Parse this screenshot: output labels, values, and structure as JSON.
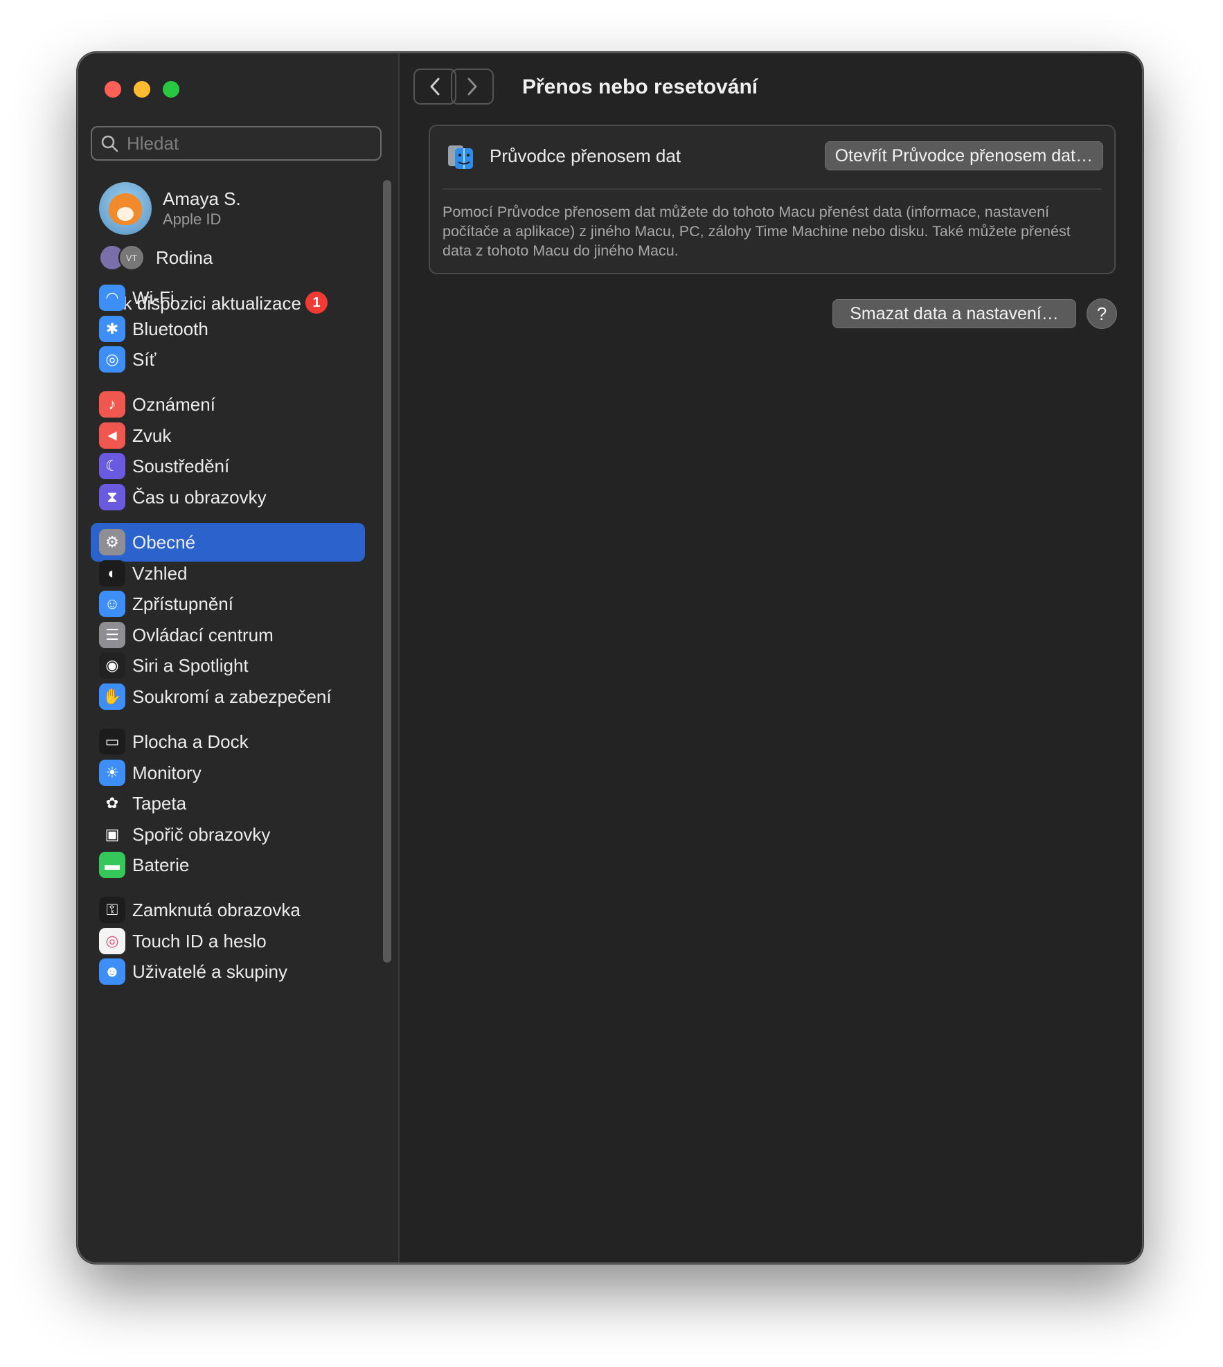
{
  "window": {
    "traffic_lights": [
      "close",
      "minimize",
      "zoom"
    ]
  },
  "search": {
    "placeholder": "Hledat"
  },
  "account": {
    "name": "Amaya S.",
    "subtitle": "Apple ID"
  },
  "family": {
    "label": "Rodina",
    "member_initials": "VT"
  },
  "update": {
    "label": "Je k dispozici aktualizace",
    "count": "1"
  },
  "sidebar": {
    "groups": [
      {
        "items": [
          {
            "label": "Wi-Fi",
            "icon": "wifi-icon",
            "color": "#3d8ef7"
          },
          {
            "label": "Bluetooth",
            "icon": "bluetooth-icon",
            "color": "#3d8ef7"
          },
          {
            "label": "Síť",
            "icon": "globe-icon",
            "color": "#3d8ef7"
          }
        ]
      },
      {
        "items": [
          {
            "label": "Oznámení",
            "icon": "bell-icon",
            "color": "#f0574f"
          },
          {
            "label": "Zvuk",
            "icon": "speaker-icon",
            "color": "#f0574f"
          },
          {
            "label": "Soustředění",
            "icon": "moon-icon",
            "color": "#6a5ae0"
          },
          {
            "label": "Čas u obrazovky",
            "icon": "hourglass-icon",
            "color": "#6a5ae0"
          }
        ]
      },
      {
        "items": [
          {
            "label": "Obecné",
            "icon": "gear-icon",
            "color": "#8e8e93",
            "active": true
          },
          {
            "label": "Vzhled",
            "icon": "appearance-icon",
            "color": "#1c1c1c"
          },
          {
            "label": "Zpřístupnění",
            "icon": "accessibility-icon",
            "color": "#3d8ef7"
          },
          {
            "label": "Ovládací centrum",
            "icon": "control-center-icon",
            "color": "#8e8e93"
          },
          {
            "label": "Siri a Spotlight",
            "icon": "siri-icon",
            "color": "#222"
          },
          {
            "label": "Soukromí a zabezpečení",
            "icon": "hand-icon",
            "color": "#3d8ef7"
          }
        ]
      },
      {
        "items": [
          {
            "label": "Plocha a Dock",
            "icon": "dock-icon",
            "color": "#1c1c1c"
          },
          {
            "label": "Monitory",
            "icon": "sun-icon",
            "color": "#3d8ef7"
          },
          {
            "label": "Tapeta",
            "icon": "flower-icon",
            "color": "#282828"
          },
          {
            "label": "Spořič obrazovky",
            "icon": "screensaver-icon",
            "color": "#282828"
          },
          {
            "label": "Baterie",
            "icon": "battery-icon",
            "color": "#35c759"
          }
        ]
      },
      {
        "items": [
          {
            "label": "Zamknutá obrazovka",
            "icon": "lock-icon",
            "color": "#1c1c1c"
          },
          {
            "label": "Touch ID a heslo",
            "icon": "fingerprint-icon",
            "color": "#f4f4f4"
          },
          {
            "label": "Uživatelé a skupiny",
            "icon": "users-icon",
            "color": "#3d8ef7"
          }
        ]
      }
    ]
  },
  "main": {
    "title": "Přenos nebo resetování",
    "migration": {
      "label": "Průvodce přenosem dat",
      "button": "Otevřít Průvodce přenosem dat…",
      "description": "Pomocí Průvodce přenosem dat můžete do tohoto Macu přenést data (informace, nastavení počítače a aplikace) z jiného Macu, PC, zálohy Time Machine nebo disku. Také můžete přenést data z tohoto Macu do jiného Macu."
    },
    "erase_button": "Smazat data a nastavení…",
    "help_button": "?"
  }
}
